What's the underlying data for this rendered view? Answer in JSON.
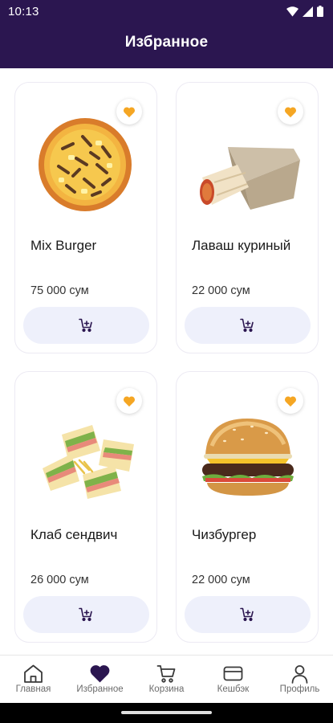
{
  "status_bar": {
    "time": "10:13"
  },
  "header": {
    "title": "Избранное"
  },
  "colors": {
    "header_bg": "#2b1650",
    "accent_heart": "#f5a623",
    "nav_active": "#2b1650",
    "button_bg": "#eef0fb"
  },
  "products": [
    {
      "name": "Mix Burger",
      "price": "75 000 сум",
      "image": "pizza-image",
      "favorite": true
    },
    {
      "name": "Лаваш куриный",
      "price": "22 000 сум",
      "image": "lavash-image",
      "favorite": true
    },
    {
      "name": "Клаб сендвич",
      "price": "26 000 сум",
      "image": "club-sandwich-image",
      "favorite": true
    },
    {
      "name": "Чизбургер",
      "price": "22 000 сум",
      "image": "cheeseburger-image",
      "favorite": true
    }
  ],
  "bottom_nav": {
    "active": "Избранное",
    "items": [
      {
        "label": "Главная",
        "icon": "home-icon"
      },
      {
        "label": "Избранное",
        "icon": "heart-icon"
      },
      {
        "label": "Корзина",
        "icon": "cart-icon"
      },
      {
        "label": "Кешбэк",
        "icon": "card-icon"
      },
      {
        "label": "Профиль",
        "icon": "user-icon"
      }
    ]
  }
}
